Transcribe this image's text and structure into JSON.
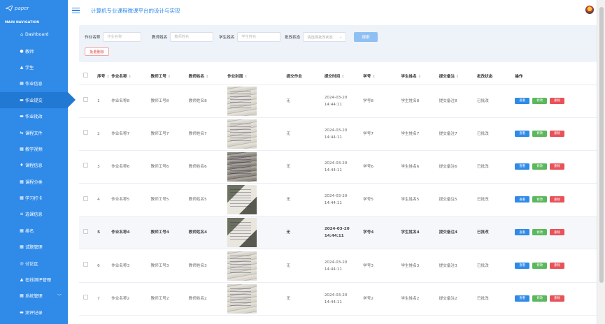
{
  "sidebar": {
    "logo": "paper",
    "heading": "MAIN NAVIGATION",
    "items": [
      {
        "label": "Dashboard",
        "icon": "home-icon",
        "glyph": "⌂"
      },
      {
        "label": "教师",
        "icon": "group-icon",
        "glyph": "●"
      },
      {
        "label": "学生",
        "icon": "user-icon",
        "glyph": "▲"
      },
      {
        "label": "作业信息",
        "icon": "grid-icon",
        "glyph": "▦"
      },
      {
        "label": "作业提交",
        "icon": "comment-icon",
        "glyph": "▬",
        "active": true
      },
      {
        "label": "作业批改",
        "icon": "comment-icon",
        "glyph": "▬"
      },
      {
        "label": "课程文件",
        "icon": "file-icon",
        "glyph": "⇆"
      },
      {
        "label": "教学视频",
        "icon": "grid-icon",
        "glyph": "▦"
      },
      {
        "label": "课程信息",
        "icon": "location-icon",
        "glyph": "♦"
      },
      {
        "label": "课程分类",
        "icon": "grid-icon",
        "glyph": "▦"
      },
      {
        "label": "学习打卡",
        "icon": "grid-icon",
        "glyph": "▦"
      },
      {
        "label": "选课信息",
        "icon": "list-icon",
        "glyph": "≡"
      },
      {
        "label": "排名",
        "icon": "grid-icon",
        "glyph": "▦"
      },
      {
        "label": "试题管理",
        "icon": "grid-icon",
        "glyph": "▦"
      },
      {
        "label": "讨论区",
        "icon": "target-icon",
        "glyph": "◎"
      },
      {
        "label": "在线测评管理",
        "icon": "user-icon",
        "glyph": "▲"
      },
      {
        "label": "系统管理",
        "icon": "grid-icon",
        "glyph": "▦",
        "chevron": "﹀"
      },
      {
        "label": "测评记录",
        "icon": "comment-icon",
        "glyph": "▬"
      }
    ]
  },
  "header": {
    "title": "计算机专业课程微课平台的设计与实现"
  },
  "search": {
    "fields": [
      {
        "label": "作业名称",
        "placeholder": "作业名称"
      },
      {
        "label": "教师姓名",
        "placeholder": "教师姓名"
      },
      {
        "label": "学生姓名",
        "placeholder": "学生姓名"
      }
    ],
    "status_label": "批改状态",
    "status_placeholder": "请选择批改状态",
    "search_button": "搜索",
    "batch_delete_button": "批量删除"
  },
  "table": {
    "columns": [
      "序号",
      "作业名称",
      "教师工号",
      "教师姓名",
      "作业封面",
      "提交作业",
      "提交时间",
      "学号",
      "学生姓名",
      "提交备注",
      "批改状态",
      "操作"
    ],
    "sortable": [
      true,
      true,
      true,
      true,
      true,
      false,
      true,
      true,
      true,
      true,
      false,
      false
    ],
    "sort_glyph": "⇕",
    "actions": {
      "view": "查看",
      "edit": "修改",
      "delete": "删除"
    },
    "rows": [
      {
        "idx": "1",
        "name": "作业名称8",
        "tid": "教师工号8",
        "tname": "教师姓名8",
        "submit": "无",
        "time": "2024-03-20 14:44:11",
        "sid": "学号8",
        "sname": "学生姓名8",
        "note": "提交备注8",
        "status": "已批改",
        "cover": "light"
      },
      {
        "idx": "2",
        "name": "作业名称7",
        "tid": "教师工号7",
        "tname": "教师姓名7",
        "submit": "无",
        "time": "2024-03-20 14:44:11",
        "sid": "学号7",
        "sname": "学生姓名7",
        "note": "提交备注7",
        "status": "已批改",
        "cover": "light"
      },
      {
        "idx": "3",
        "name": "作业名称6",
        "tid": "教师工号6",
        "tname": "教师姓名6",
        "submit": "无",
        "time": "2024-03-20 14:44:11",
        "sid": "学号6",
        "sname": "学生姓名6",
        "note": "提交备注6",
        "status": "已批改",
        "cover": "dark"
      },
      {
        "idx": "4",
        "name": "作业名称5",
        "tid": "教师工号5",
        "tname": "教师姓名5",
        "submit": "无",
        "time": "2024-03-20 14:44:11",
        "sid": "学号5",
        "sname": "学生姓名5",
        "note": "提交备注5",
        "status": "已批改",
        "cover": "photo"
      },
      {
        "idx": "5",
        "name": "作业名称4",
        "tid": "教师工号4",
        "tname": "教师姓名4",
        "submit": "无",
        "time": "2024-03-20 14:44:11",
        "sid": "学号4",
        "sname": "学生姓名4",
        "note": "提交备注4",
        "status": "已批改",
        "cover": "photo",
        "highlight": true
      },
      {
        "idx": "6",
        "name": "作业名称3",
        "tid": "教师工号3",
        "tname": "教师姓名3",
        "submit": "无",
        "time": "2024-03-20 14:44:11",
        "sid": "学号3",
        "sname": "学生姓名3",
        "note": "提交备注3",
        "status": "已批改",
        "cover": "light"
      },
      {
        "idx": "7",
        "name": "作业名称2",
        "tid": "教师工号2",
        "tname": "教师姓名2",
        "submit": "无",
        "time": "2024-03-20 14:44:11",
        "sid": "学号2",
        "sname": "学生姓名2",
        "note": "提交备注2",
        "status": "已批改",
        "cover": "light"
      }
    ]
  },
  "colors": {
    "primary": "#2f8ae8",
    "sidebar_active": "#2279d3",
    "edit": "#5cb85c",
    "delete": "#e8525a"
  }
}
